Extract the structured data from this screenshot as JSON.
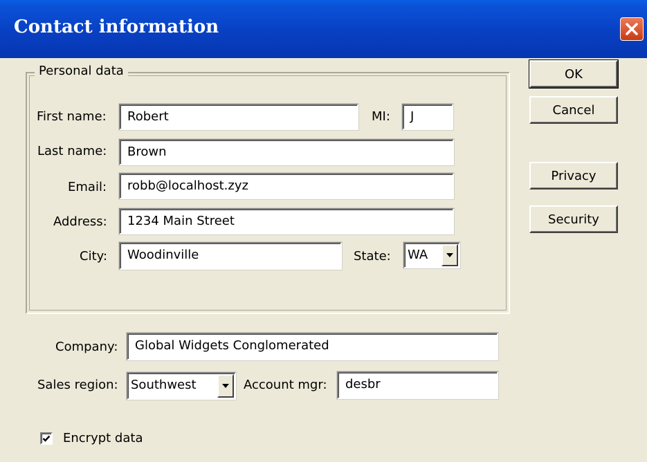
{
  "window": {
    "title": "Contact information"
  },
  "personal_data": {
    "legend": "Personal data",
    "first_name": {
      "label": "First name:",
      "value": "Robert"
    },
    "mi": {
      "label": "MI:",
      "value": "J"
    },
    "last_name": {
      "label": "Last name:",
      "value": "Brown"
    },
    "email": {
      "label": "Email:",
      "value": "robb@localhost.zyz"
    },
    "address": {
      "label": "Address:",
      "value": "1234 Main Street"
    },
    "city": {
      "label": "City:",
      "value": "Woodinville"
    },
    "state": {
      "label": "State:",
      "value": "WA"
    }
  },
  "company": {
    "label": "Company:",
    "value": "Global Widgets Conglomerated"
  },
  "sales_region": {
    "label": "Sales region:",
    "value": "Southwest"
  },
  "account_mgr": {
    "label": "Account mgr:",
    "value": "desbr"
  },
  "encrypt": {
    "label": "Encrypt data",
    "checked": true
  },
  "buttons": {
    "ok": "OK",
    "cancel": "Cancel",
    "privacy": "Privacy",
    "security": "Security"
  },
  "icons": {
    "close": "close-icon",
    "dropdown": "chevron-down-icon",
    "check": "checkmark-icon"
  },
  "colors": {
    "titlebar": "#0840c2",
    "face": "#ece9d8",
    "close": "#d9542f"
  }
}
